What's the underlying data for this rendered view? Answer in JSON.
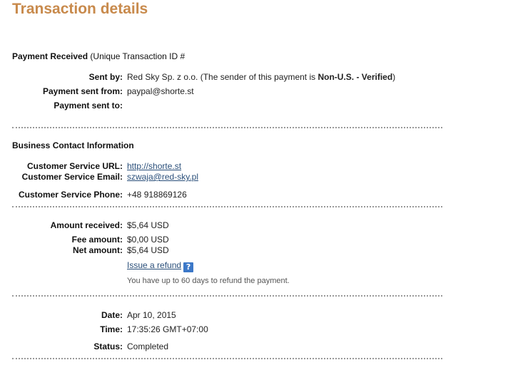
{
  "page": {
    "title": "Transaction details"
  },
  "payment": {
    "heading": "Payment Received",
    "heading_suffix": "(Unique Transaction ID #",
    "sent_by_label": "Sent by:",
    "sent_by_name": "Red Sky Sp. z o.o.",
    "sender_note_prefix": "(The sender of this payment is ",
    "sender_status": "Non-U.S. - Verified",
    "sender_note_suffix": ")",
    "sent_from_label": "Payment sent from:",
    "sent_from_value": "paypal@shorte.st",
    "sent_to_label": "Payment sent to:",
    "sent_to_value": ""
  },
  "contact": {
    "heading": "Business Contact Information",
    "url_label": "Customer Service URL:",
    "url_value": "http://shorte.st",
    "email_label": "Customer Service Email:",
    "email_value": "szwaja@red-sky.pl",
    "phone_label": "Customer Service Phone:",
    "phone_value": "+48 918869126"
  },
  "amounts": {
    "received_label": "Amount received:",
    "received_value": "$5,64 USD",
    "fee_label": "Fee amount:",
    "fee_value": "$0,00 USD",
    "net_label": "Net amount:",
    "net_value": "$5,64 USD",
    "refund_link": "Issue a refund",
    "help_icon": "?",
    "refund_note": "You have up to 60 days to refund the payment."
  },
  "details": {
    "date_label": "Date:",
    "date_value": "Apr 10, 2015",
    "time_label": "Time:",
    "time_value": "17:35:26 GMT+07:00",
    "status_label": "Status:",
    "status_value": "Completed"
  },
  "colors": {
    "title": "#c88a4c",
    "link": "#2a4f7a",
    "help_icon_bg": "#3c78c8",
    "divider": "#999999"
  }
}
